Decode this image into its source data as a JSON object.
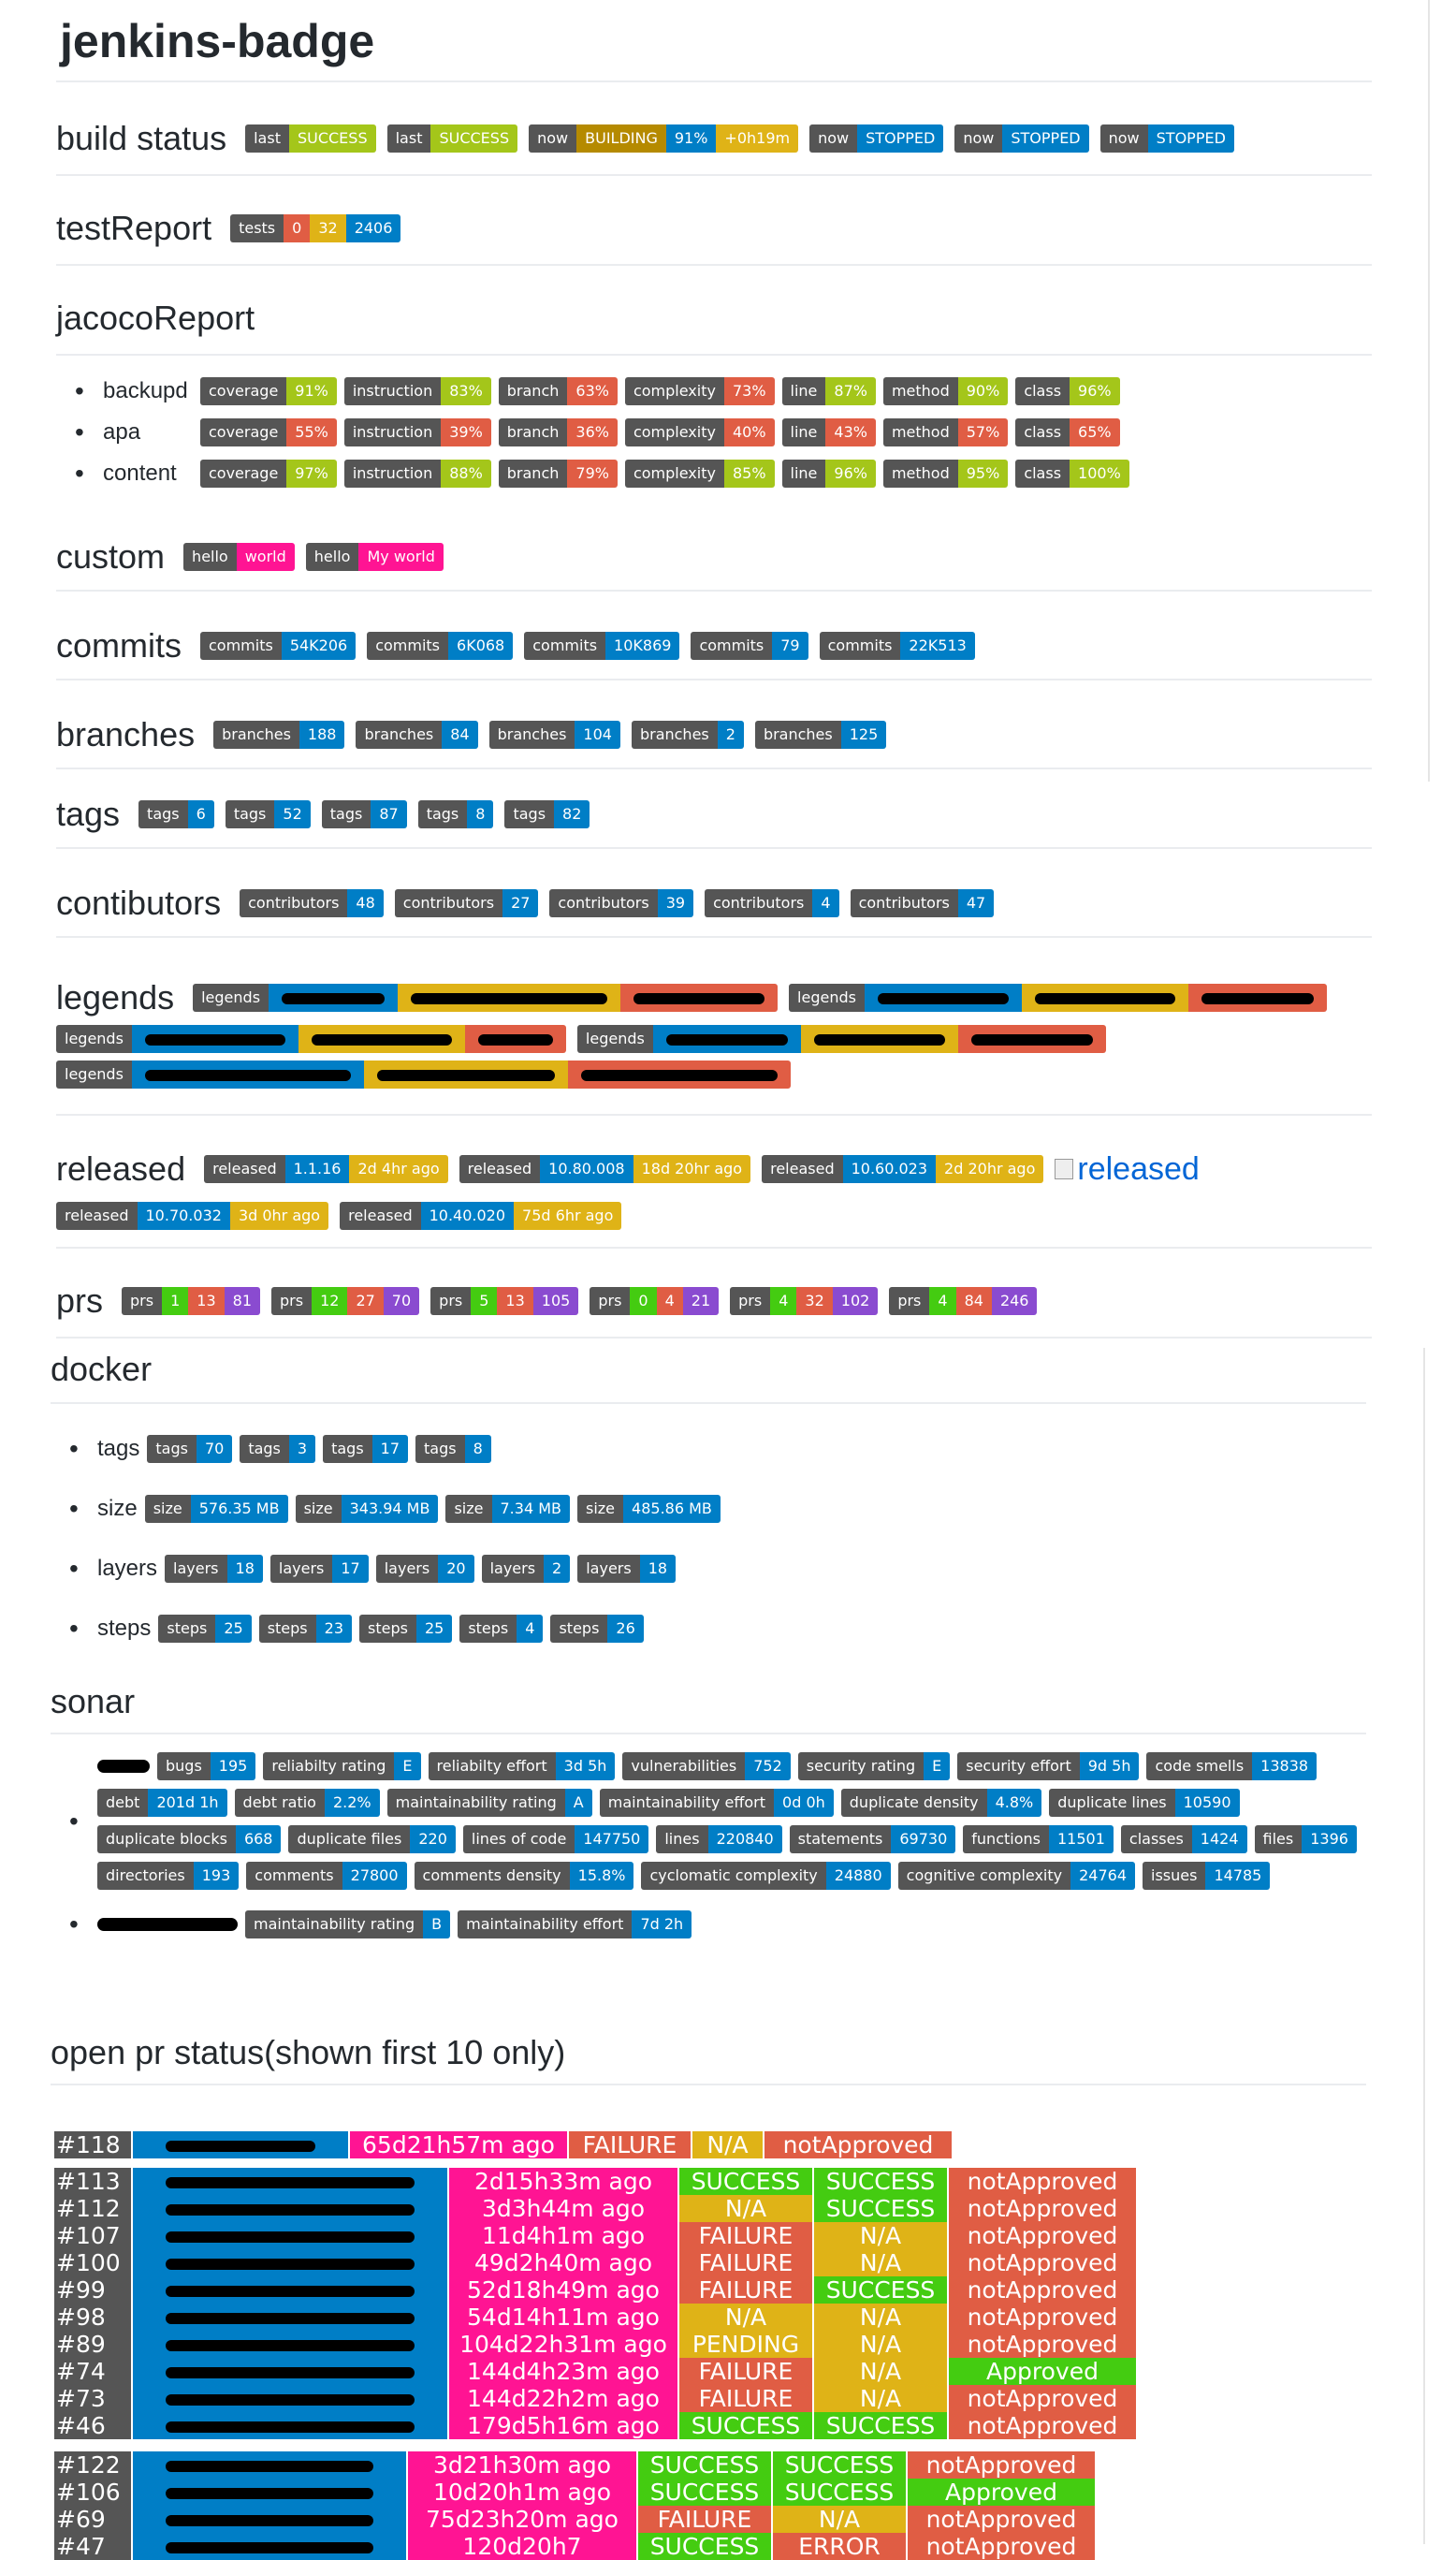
{
  "title": "jenkins-badge",
  "build": {
    "title": "build status",
    "badges": [
      {
        "l": "last",
        "r": "SUCCESS",
        "c": "yg"
      },
      {
        "l": "last",
        "r": "SUCCESS",
        "c": "yg"
      },
      {
        "l": "now",
        "r": "BUILDING",
        "c": "dgold",
        "r2": "91%",
        "c2": "blue",
        "r3": "+0h19m",
        "c3": "gold"
      },
      {
        "l": "now",
        "r": "STOPPED",
        "c": "blue"
      },
      {
        "l": "now",
        "r": "STOPPED",
        "c": "blue"
      },
      {
        "l": "now",
        "r": "STOPPED",
        "c": "blue"
      }
    ]
  },
  "test": {
    "title": "testReport",
    "label": "tests",
    "v1": "0",
    "v2": "32",
    "v3": "2406"
  },
  "jacoco": {
    "title": "jacocoReport",
    "items": [
      {
        "name": "backupd",
        "vals": [
          [
            "coverage",
            "91%",
            "yg"
          ],
          [
            "instruction",
            "83%",
            "yg"
          ],
          [
            "branch",
            "63%",
            "red"
          ],
          [
            "complexity",
            "73%",
            "red"
          ],
          [
            "line",
            "87%",
            "yg"
          ],
          [
            "method",
            "90%",
            "yg"
          ],
          [
            "class",
            "96%",
            "yg"
          ]
        ]
      },
      {
        "name": "apa",
        "vals": [
          [
            "coverage",
            "55%",
            "red"
          ],
          [
            "instruction",
            "39%",
            "red"
          ],
          [
            "branch",
            "36%",
            "red"
          ],
          [
            "complexity",
            "40%",
            "red"
          ],
          [
            "line",
            "43%",
            "red"
          ],
          [
            "method",
            "57%",
            "red"
          ],
          [
            "class",
            "65%",
            "red"
          ]
        ]
      },
      {
        "name": "content",
        "vals": [
          [
            "coverage",
            "97%",
            "yg"
          ],
          [
            "instruction",
            "88%",
            "yg"
          ],
          [
            "branch",
            "79%",
            "red"
          ],
          [
            "complexity",
            "85%",
            "yg"
          ],
          [
            "line",
            "96%",
            "yg"
          ],
          [
            "method",
            "95%",
            "yg"
          ],
          [
            "class",
            "100%",
            "yg"
          ]
        ]
      }
    ]
  },
  "custom": {
    "title": "custom",
    "badges": [
      [
        "hello",
        "world"
      ],
      [
        "hello",
        "My world"
      ]
    ]
  },
  "commits": {
    "title": "commits",
    "label": "commits",
    "vals": [
      "54K206",
      "6K068",
      "10K869",
      "79",
      "22K513"
    ]
  },
  "branches": {
    "title": "branches",
    "label": "branches",
    "vals": [
      "188",
      "84",
      "104",
      "2",
      "125"
    ]
  },
  "tags": {
    "title": "tags",
    "label": "tags",
    "vals": [
      "6",
      "52",
      "87",
      "8",
      "82"
    ]
  },
  "contributors": {
    "title": "contibutors",
    "label": "contributors",
    "vals": [
      "48",
      "27",
      "39",
      "4",
      "47"
    ]
  },
  "legends": {
    "title": "legends",
    "label": "legends"
  },
  "released": {
    "title": "released",
    "label": "released",
    "alt": "released",
    "badges": [
      [
        "1.1.16",
        "2d 4hr ago"
      ],
      [
        "10.80.008",
        "18d 20hr ago"
      ],
      [
        "10.60.023",
        "2d 20hr ago"
      ],
      [
        "10.70.032",
        "3d 0hr ago"
      ],
      [
        "10.40.020",
        "75d 6hr ago"
      ]
    ]
  },
  "prs": {
    "title": "prs",
    "label": "prs",
    "badges": [
      [
        "1",
        "13",
        "81"
      ],
      [
        "12",
        "27",
        "70"
      ],
      [
        "5",
        "13",
        "105"
      ],
      [
        "0",
        "4",
        "21"
      ],
      [
        "4",
        "32",
        "102"
      ],
      [
        "4",
        "84",
        "246"
      ]
    ]
  },
  "docker": {
    "title": "docker",
    "rows": [
      {
        "name": "tags",
        "label": "tags",
        "vals": [
          "70",
          "3",
          "17",
          "8"
        ]
      },
      {
        "name": "size",
        "label": "size",
        "vals": [
          "576.35 MB",
          "343.94 MB",
          "7.34 MB",
          "485.86 MB"
        ]
      },
      {
        "name": "layers",
        "label": "layers",
        "vals": [
          "18",
          "17",
          "20",
          "2",
          "18"
        ]
      },
      {
        "name": "steps",
        "label": "steps",
        "vals": [
          "25",
          "23",
          "25",
          "4",
          "26"
        ]
      }
    ]
  },
  "sonar": {
    "title": "sonar",
    "first": [
      [
        "bugs",
        "195"
      ],
      [
        "reliabilty rating",
        "E"
      ],
      [
        "reliabilty effort",
        "3d 5h"
      ],
      [
        "vulnerabilities",
        "752"
      ],
      [
        "security rating",
        "E"
      ],
      [
        "security effort",
        "9d 5h"
      ],
      [
        "code smells",
        "13838"
      ],
      [
        "debt",
        "201d 1h"
      ],
      [
        "debt ratio",
        "2.2%"
      ],
      [
        "maintainability rating",
        "A"
      ],
      [
        "maintainability effort",
        "0d 0h"
      ],
      [
        "duplicate density",
        "4.8%"
      ],
      [
        "duplicate lines",
        "10590"
      ],
      [
        "duplicate blocks",
        "668"
      ],
      [
        "duplicate files",
        "220"
      ],
      [
        "lines of code",
        "147750"
      ],
      [
        "lines",
        "220840"
      ],
      [
        "statements",
        "69730"
      ],
      [
        "functions",
        "11501"
      ],
      [
        "classes",
        "1424"
      ],
      [
        "files",
        "1396"
      ],
      [
        "directories",
        "193"
      ],
      [
        "comments",
        "27800"
      ],
      [
        "comments density",
        "15.8%"
      ],
      [
        "cyclomatic complexity",
        "24880"
      ],
      [
        "cognitive complexity",
        "24764"
      ],
      [
        "issues",
        "14785"
      ]
    ],
    "second": [
      [
        "maintainability rating",
        "B"
      ],
      [
        "maintainability effort",
        "7d 2h"
      ]
    ]
  },
  "openpr": {
    "title": "open pr status(shown first 10 only)",
    "t1": [
      [
        "#118",
        "65d21h57m ago",
        "FAILURE",
        "N/A",
        "notApproved"
      ]
    ],
    "t2": [
      [
        "#113",
        "2d15h33m ago",
        "SUCCESS",
        "SUCCESS",
        "notApproved"
      ],
      [
        "#112",
        "3d3h44m ago",
        "N/A",
        "SUCCESS",
        "notApproved"
      ],
      [
        "#107",
        "11d4h1m ago",
        "FAILURE",
        "N/A",
        "notApproved"
      ],
      [
        "#100",
        "49d2h40m ago",
        "FAILURE",
        "N/A",
        "notApproved"
      ],
      [
        "#99",
        "52d18h49m ago",
        "FAILURE",
        "SUCCESS",
        "notApproved"
      ],
      [
        "#98",
        "54d14h11m ago",
        "N/A",
        "N/A",
        "notApproved"
      ],
      [
        "#89",
        "104d22h31m ago",
        "PENDING",
        "N/A",
        "notApproved"
      ],
      [
        "#74",
        "144d4h23m ago",
        "FAILURE",
        "N/A",
        "Approved"
      ],
      [
        "#73",
        "144d22h2m ago",
        "FAILURE",
        "N/A",
        "notApproved"
      ],
      [
        "#46",
        "179d5h16m ago",
        "SUCCESS",
        "SUCCESS",
        "notApproved"
      ]
    ],
    "t3": [
      [
        "#122",
        "3d21h30m ago",
        "SUCCESS",
        "SUCCESS",
        "notApproved"
      ],
      [
        "#106",
        "10d20h1m ago",
        "SUCCESS",
        "SUCCESS",
        "Approved"
      ],
      [
        "#69",
        "75d23h20m ago",
        "FAILURE",
        "N/A",
        "notApproved"
      ],
      [
        "#47",
        "120d20h7",
        "SUCCESS",
        "ERROR",
        "notApproved"
      ]
    ]
  }
}
